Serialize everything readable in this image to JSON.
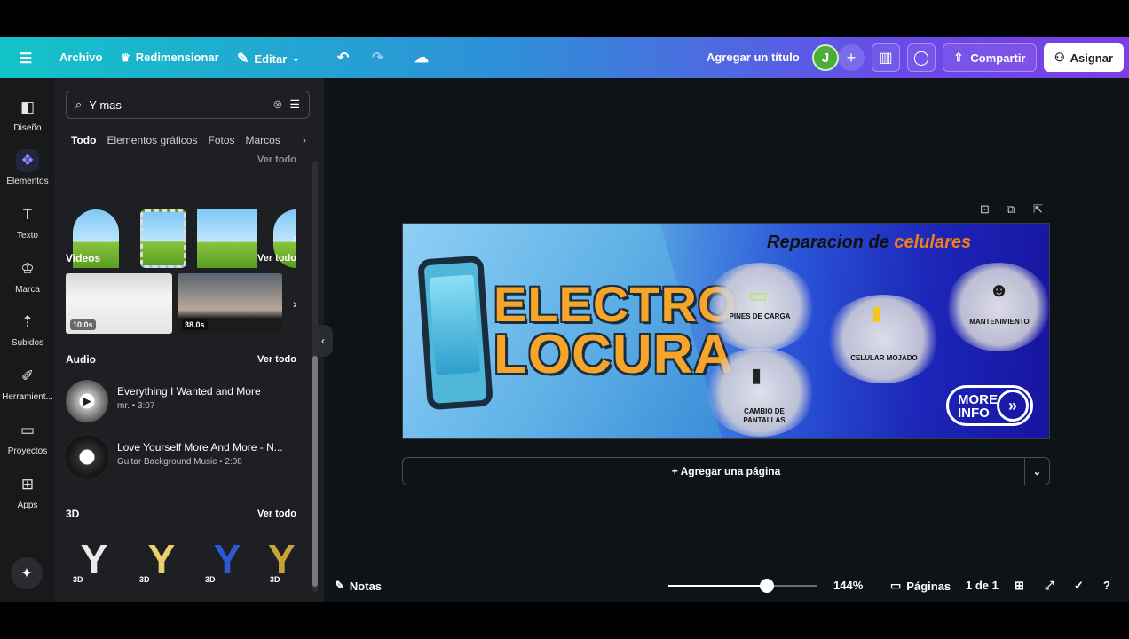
{
  "topbar": {
    "file_label": "Archivo",
    "resize_label": "Redimensionar",
    "edit_label": "Editar",
    "title_placeholder": "Agregar un título",
    "avatar_initial": "J",
    "share_label": "Compartir",
    "assign_label": "Asignar"
  },
  "rail": {
    "items": [
      {
        "label": "Diseño",
        "icon": "design-icon"
      },
      {
        "label": "Elementos",
        "icon": "elements-icon"
      },
      {
        "label": "Texto",
        "icon": "text-icon"
      },
      {
        "label": "Marca",
        "icon": "brand-icon"
      },
      {
        "label": "Subidos",
        "icon": "upload-icon"
      },
      {
        "label": "Herramient...",
        "icon": "tools-icon"
      },
      {
        "label": "Proyectos",
        "icon": "folder-icon"
      },
      {
        "label": "Apps",
        "icon": "apps-icon"
      }
    ]
  },
  "panel": {
    "search_value": "Y mas",
    "tabs": [
      "Todo",
      "Elementos gráficos",
      "Fotos",
      "Marcos"
    ],
    "see_all": "Ver todo",
    "sections": {
      "videos": "Videos",
      "audio": "Audio",
      "three_d": "3D"
    },
    "videos": [
      {
        "duration": "10.0s"
      },
      {
        "duration": "38.0s"
      }
    ],
    "audio": [
      {
        "title": "Everything I Wanted and More",
        "meta": "mr. • 3:07"
      },
      {
        "title": "Love Yourself More And More - N...",
        "meta": "Guitar Background Music • 2:08"
      }
    ],
    "three_d_badge": "3D"
  },
  "design": {
    "brand_line1": "ELECTRO",
    "brand_line2": "LOCURA",
    "title_main": "Reparacion de ",
    "title_accent": "celulares",
    "services": {
      "pines": "PINES DE CARGA",
      "celular": "CELULAR MOJADO",
      "mantenimiento": "MANTENIMIENTO",
      "cambio": "CAMBIO DE PANTALLAS"
    },
    "more_info": "MORE INFO"
  },
  "canvas": {
    "add_page": "+ Agregar una página"
  },
  "footer": {
    "notes": "Notas",
    "zoom": "144%",
    "zoom_fraction": 0.65,
    "pages": "Páginas",
    "page_count": "1 de 1"
  },
  "colors": {
    "accent": "#7b3fe4",
    "brand_orange": "#f6a52a"
  }
}
